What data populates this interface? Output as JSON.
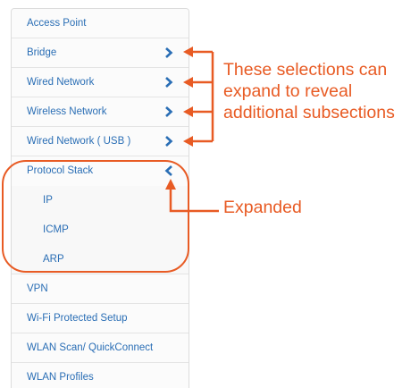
{
  "menu": {
    "items": [
      {
        "label": "Access Point",
        "chevron": "none"
      },
      {
        "label": "Bridge",
        "chevron": "right"
      },
      {
        "label": "Wired Network",
        "chevron": "right"
      },
      {
        "label": "Wireless Network",
        "chevron": "right"
      },
      {
        "label": "Wired Network ( USB )",
        "chevron": "right"
      },
      {
        "label": "Protocol Stack",
        "chevron": "left",
        "expanded": true
      },
      {
        "label": "IP",
        "sub": true
      },
      {
        "label": "ICMP",
        "sub": true
      },
      {
        "label": "ARP",
        "sub": true
      },
      {
        "label": "VPN",
        "chevron": "none"
      },
      {
        "label": "Wi-Fi Protected Setup",
        "chevron": "none"
      },
      {
        "label": "WLAN Scan/ QuickConnect",
        "chevron": "none"
      },
      {
        "label": "WLAN Profiles",
        "chevron": "none"
      }
    ]
  },
  "annotations": {
    "expandable_line1": "These selections can",
    "expandable_line2": "expand to reveal",
    "expandable_line3": "additional subsections",
    "expanded": "Expanded"
  },
  "colors": {
    "link": "#2a6eb5",
    "chevron": "#2a6eb5",
    "annotation": "#e85b24",
    "border": "#dcdcdc"
  },
  "icons": {
    "collapsed": "chevron-right-icon",
    "expanded": "chevron-left-icon"
  }
}
